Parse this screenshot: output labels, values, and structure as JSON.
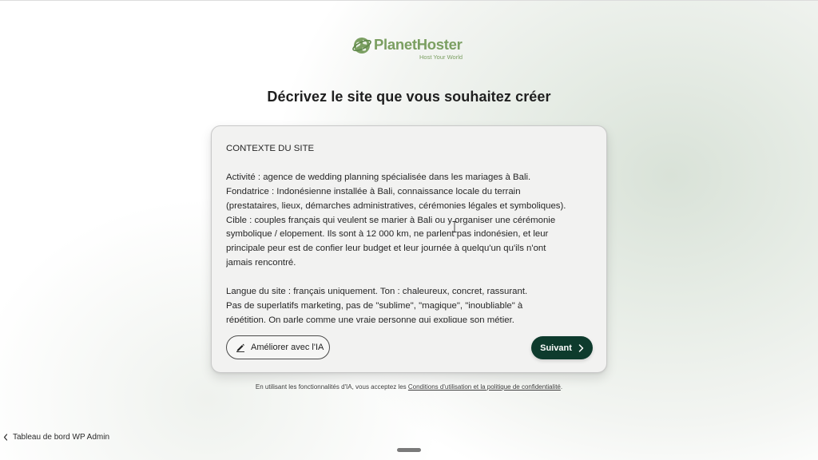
{
  "brand": {
    "name": "PlanetHoster",
    "tagline": "Host Your World",
    "color": "#7b9f62"
  },
  "page": {
    "title": "Décrivez le site que vous souhaitez créer"
  },
  "form": {
    "description_value": "CONTEXTE DU SITE\n\nActivité : agence de wedding planning spécialisée dans les mariages à Bali.\nFondatrice : Indonésienne installée à Bali, connaissance locale du terrain\n(prestataires, lieux, démarches administratives, cérémonies légales et symboliques).\nCible : couples français qui veulent se marier à Bali ou y organiser une cérémonie\nsymbolique / elopement. Ils sont à 12 000 km, ne parlent pas indonésien, et leur\nprincipale peur est de confier leur budget et leur journée à quelqu'un qu'ils n'ont\njamais rencontré.\n\nLangue du site : français uniquement. Ton : chaleureux, concret, rassurant.\nPas de superlatifs marketing, pas de \"sublime\", \"magique\", \"inoubliable\" à\nrépétition. On parle comme une vraie personne qui explique son métier.",
    "improve_label": "Améliorer avec l'IA",
    "next_label": "Suivant",
    "next_color": "#0e3b2d"
  },
  "disclaimer": {
    "prefix": "En utilisant les fonctionnalités d'IA, vous acceptez les ",
    "link": "Conditions d'utilisation et la politique de confidentialité",
    "suffix": "."
  },
  "footer": {
    "back_label": "Tableau de bord WP Admin"
  },
  "icons": {
    "logo": "globe-icon",
    "improve": "pen-icon",
    "next": "chevron-right-icon",
    "back": "chevron-left-icon"
  }
}
